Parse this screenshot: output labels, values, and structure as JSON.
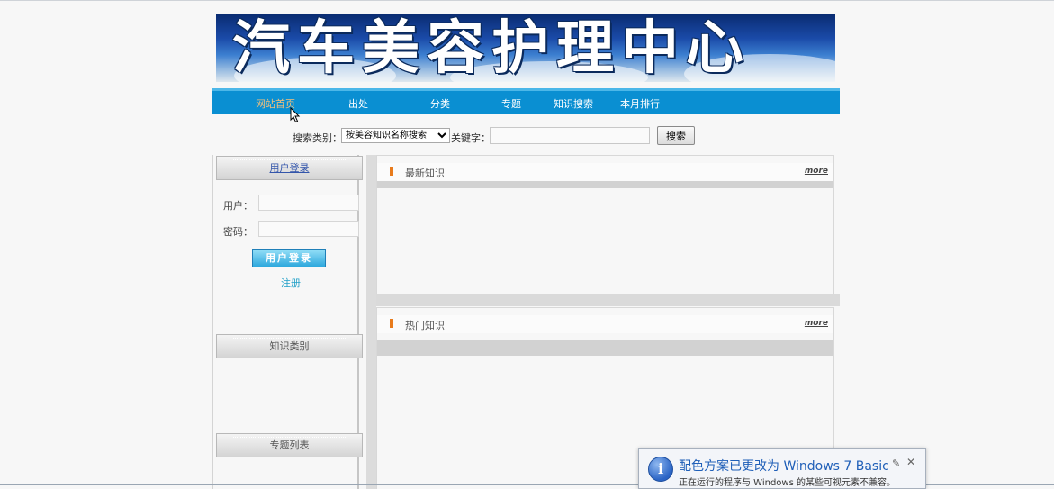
{
  "banner": {
    "title": "汽车美容护理中心"
  },
  "nav": {
    "items": [
      {
        "label": "网站首页",
        "active": true
      },
      {
        "label": "出处"
      },
      {
        "label": "分类"
      },
      {
        "label": "专题"
      },
      {
        "label": "知识搜索"
      },
      {
        "label": "本月排行"
      }
    ]
  },
  "search": {
    "category_label": "搜索类别：",
    "category_selected": "按美容知识名称搜索",
    "keyword_label": "关键字：",
    "keyword_value": "",
    "button_label": "搜索"
  },
  "sidebar": {
    "login": {
      "title": "用户登录",
      "user_label": "用户：",
      "password_label": "密码：",
      "login_button": "用户登录",
      "register_link": "注册"
    },
    "categories": {
      "title": "知识类别"
    },
    "topics": {
      "title": "专题列表"
    }
  },
  "main": {
    "latest": {
      "title": "最新知识",
      "more": "more"
    },
    "hot": {
      "title": "热门知识",
      "more": "more"
    }
  },
  "notification": {
    "title": "配色方案已更改为 Windows 7 Basic",
    "message": "正在运行的程序与 Windows 的某些可视元素不兼容。"
  },
  "colors": {
    "nav_bg": "#0a8fd2",
    "nav_active": "#f5c07a",
    "accent_bar": "#e87b1c",
    "register_link": "#22a0c8",
    "notification_title": "#1f5fb8"
  }
}
